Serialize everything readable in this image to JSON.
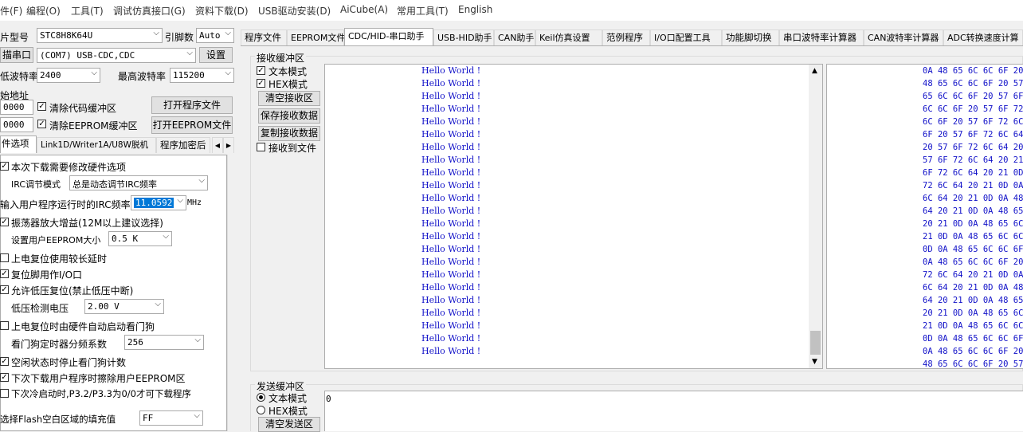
{
  "menu": [
    "件(F)",
    "编程(O)",
    "工具(T)",
    "调试仿真接口(G)",
    "资料下载(D)",
    "USB驱动安装(D)",
    "AiCube(A)",
    "常用工具(T)",
    "English"
  ],
  "left": {
    "chip_label": "片型号",
    "chip_value": "STC8H8K64U",
    "pin_label": "引脚数",
    "pin_value": "Auto",
    "scan_label": "描串口",
    "port_value": "(COM7) USB-CDC,CDC",
    "settings_btn": "设置",
    "minbaud_label": "低波特率",
    "minbaud_value": "2400",
    "maxbaud_label": "最高波特率",
    "maxbaud_value": "115200",
    "start_addr_label": "始地址",
    "addr1": "0000",
    "addr2": "0000",
    "clear_code": "清除代码缓冲区",
    "clear_eeprom": "清除EEPROM缓冲区",
    "open_prog_btn": "打开程序文件",
    "open_eeprom_btn": "打开EEPROM文件",
    "tabs": [
      "件选项",
      "Link1D/Writer1A/U8W脱机",
      "程序加密后"
    ],
    "opt_modify_hw": "本次下载需要修改硬件选项",
    "irc_mode_label": "IRC调节模式",
    "irc_mode_value": "总是动态调节IRC频率",
    "irc_freq_label": "输入用户程序运行时的IRC频率",
    "irc_freq_value": "11.0592",
    "irc_unit": "MHz",
    "opt_osc": "振荡器放大增益(12M以上建议选择)",
    "eeprom_size_label": "设置用户EEPROM大小",
    "eeprom_size_value": "0.5 K",
    "opt_long_delay": "上电复位使用较长延时",
    "opt_reset_io": "复位脚用作I/O口",
    "opt_lvr": "允许低压复位(禁止低压中断)",
    "lvd_label": "低压检测电压",
    "lvd_value": "2.00 V",
    "opt_wdt": "上电复位时由硬件自动启动看门狗",
    "wdt_div_label": "看门狗定时器分频系数",
    "wdt_div_value": "256",
    "opt_idle_wdt": "空闲状态时停止看门狗计数",
    "opt_erase_eeprom": "下次下载用户程序时擦除用户EEPROM区",
    "opt_p32": "下次冷启动时,P3.2/P3.3为0/0才可下载程序",
    "flash_fill_label": "选择Flash空白区域的填充值",
    "flash_fill_value": "FF"
  },
  "right_tabs": [
    "程序文件",
    "EEPROM文件",
    "CDC/HID-串口助手",
    "USB-HID助手",
    "CAN助手",
    "Keil仿真设置",
    "范例程序",
    "I/O口配置工具",
    "功能脚切换",
    "串口波特率计算器",
    "CAN波特率计算器",
    "ADC转换速度计算"
  ],
  "receive": {
    "title": "接收缓冲区",
    "text_mode": "文本模式",
    "hex_mode": "HEX模式",
    "clear_btn": "清空接收区",
    "save_btn": "保存接收数据",
    "copy_btn": "复制接收数据",
    "to_file": "接收到文件",
    "lines": [
      "Hello World !",
      "Hello World !",
      "Hello World !",
      "Hello World !",
      "Hello World !",
      "Hello World !",
      "Hello World !",
      "Hello World !",
      "Hello World !",
      "Hello World !",
      "Hello World !",
      "Hello World !",
      "Hello World !",
      "Hello World !",
      "Hello World !",
      "Hello World !",
      "Hello World !",
      "Hello World !",
      "Hello World !",
      "Hello World !",
      "Hello World !",
      "Hello World !",
      "Hello World !"
    ],
    "hex_lines": [
      "0A 48 65 6C 6C 6F 20",
      "48 65 6C 6C 6F 20 57",
      "65 6C 6C 6F 20 57 6F",
      "6C 6C 6F 20 57 6F 72",
      "6C 6F 20 57 6F 72 6C",
      "6F 20 57 6F 72 6C 64",
      "20 57 6F 72 6C 64 20",
      "57 6F 72 6C 64 20 21",
      "6F 72 6C 64 20 21 0D",
      "72 6C 64 20 21 0D 0A",
      "6C 64 20 21 0D 0A 48",
      "64 20 21 0D 0A 48 65",
      "20 21 0D 0A 48 65 6C",
      "21 0D 0A 48 65 6C 6C",
      "0D 0A 48 65 6C 6C 6F",
      "0A 48 65 6C 6C 6F 20",
      "72 6C 64 20 21 0D 0A",
      "6C 64 20 21 0D 0A 48",
      "64 20 21 0D 0A 48 65",
      "20 21 0D 0A 48 65 6C",
      "21 0D 0A 48 65 6C 6C",
      "0D 0A 48 65 6C 6C 6F",
      "0A 48 65 6C 6C 6F 20",
      "48 65 6C 6C 6F 20 57"
    ]
  },
  "send": {
    "title": "发送缓冲区",
    "text_mode": "文本模式",
    "hex_mode": "HEX模式",
    "clear_btn": "清空发送区",
    "value": "0"
  }
}
